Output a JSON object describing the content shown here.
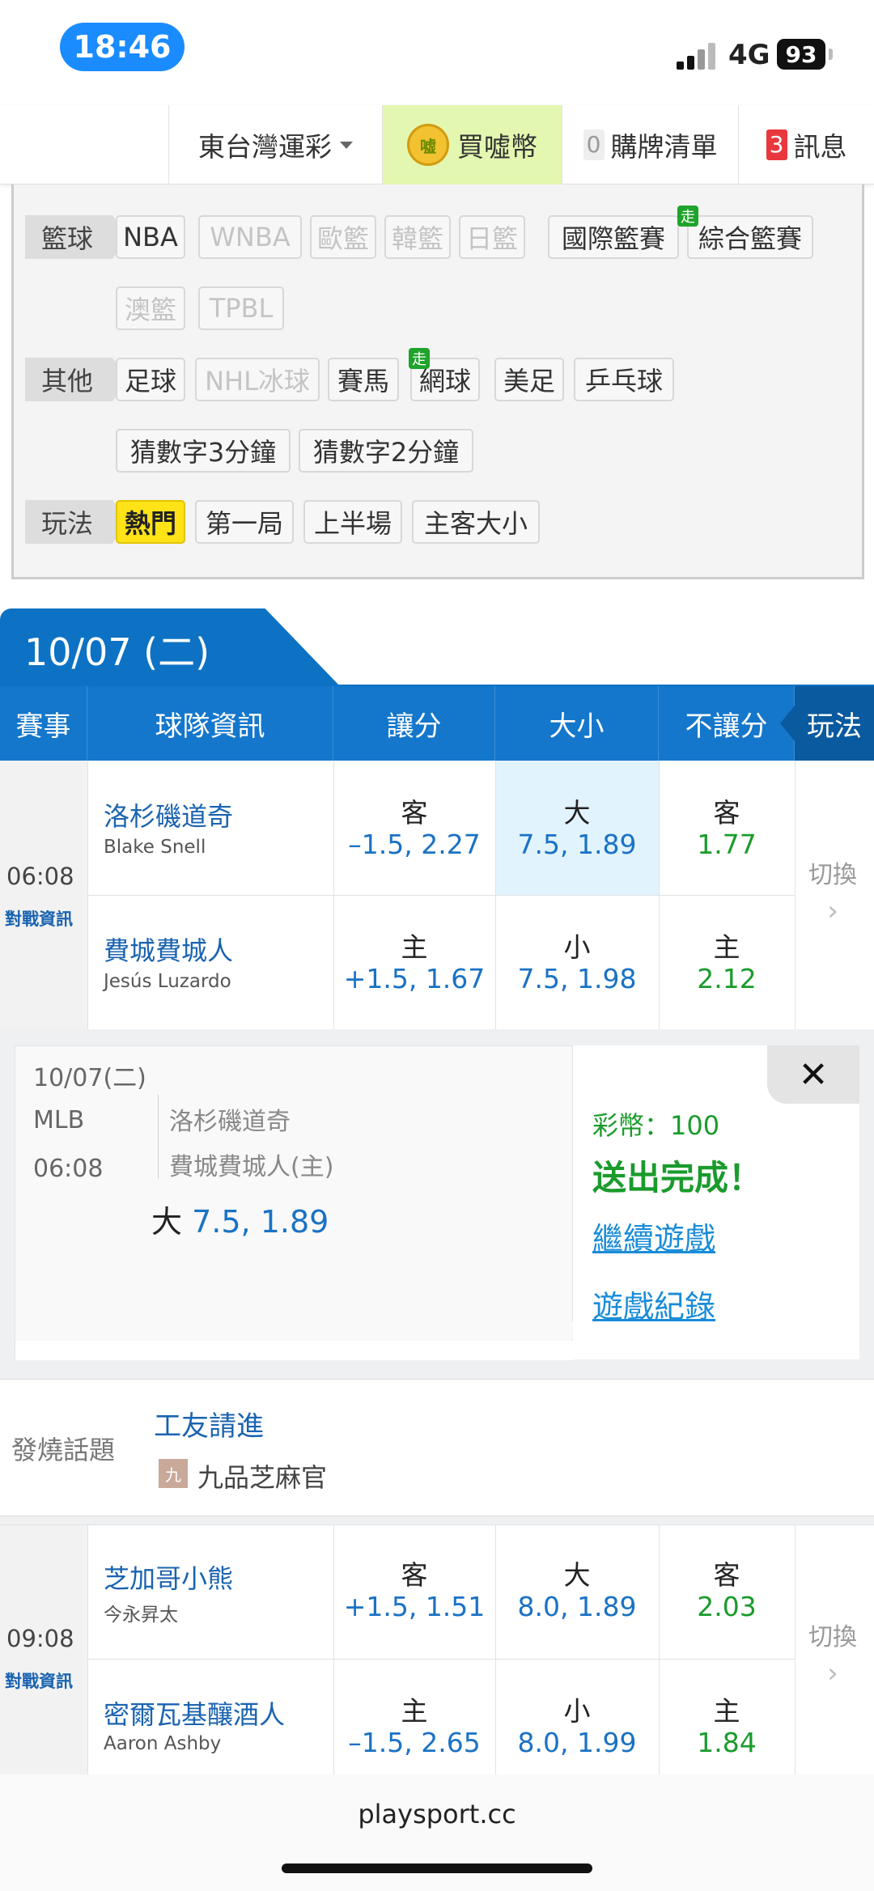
{
  "status_bar": {
    "time": "18:46",
    "network": "4G",
    "battery": "93"
  },
  "nav": {
    "lottery": "東台灣運彩",
    "coin_icon_text": "嘘",
    "buy_coin": "買噓幣",
    "cart_count": "0",
    "cart": "購牌清單",
    "msg_count": "3",
    "messages": "訊息"
  },
  "filter": {
    "basketball": {
      "label": "籃球",
      "chips": [
        "NBA",
        "WNBA",
        "歐籃",
        "韓籃",
        "日籃",
        "國際籃賽",
        "綜合籃賽",
        "澳籃",
        "TPBL"
      ]
    },
    "other": {
      "label": "其他",
      "chips": [
        "足球",
        "NHL冰球",
        "賽馬",
        "網球",
        "美足",
        "乒乓球",
        "猜數字3分鐘",
        "猜數字2分鐘"
      ]
    },
    "play": {
      "label": "玩法",
      "chips": [
        "熱門",
        "第一局",
        "上半場",
        "主客大小"
      ]
    },
    "walk_badge": "走"
  },
  "date_tab": "10/07 (二)",
  "table_header": {
    "event": "賽事",
    "team_info": "球隊資訊",
    "spread": "讓分",
    "total": "大小",
    "moneyline": "不讓分",
    "play": "玩法"
  },
  "games": [
    {
      "time": "06:08",
      "vs_link": "對戰資訊",
      "switch": "切換",
      "away": {
        "team": "洛杉磯道奇",
        "pitcher": "Blake Snell",
        "spread_lbl": "客",
        "spread": "–1.5, 2.27",
        "total_lbl": "大",
        "total": "7.5, 1.89",
        "ml_lbl": "客",
        "ml": "1.77"
      },
      "home": {
        "team": "費城費城人",
        "pitcher": "Jesús Luzardo",
        "spread_lbl": "主",
        "spread": "+1.5, 1.67",
        "total_lbl": "小",
        "total": "7.5, 1.98",
        "ml_lbl": "主",
        "ml": "2.12"
      }
    },
    {
      "time": "09:08",
      "vs_link": "對戰資訊",
      "switch": "切換",
      "away": {
        "team": "芝加哥小熊",
        "pitcher": "今永昇太",
        "spread_lbl": "客",
        "spread": "+1.5, 1.51",
        "total_lbl": "大",
        "total": "8.0, 1.89",
        "ml_lbl": "客",
        "ml": "2.03"
      },
      "home": {
        "team": "密爾瓦基釀酒人",
        "pitcher": "Aaron Ashby",
        "spread_lbl": "主",
        "spread": "–1.5, 2.65",
        "total_lbl": "小",
        "total": "8.0, 1.99",
        "ml_lbl": "主",
        "ml": "1.84"
      }
    }
  ],
  "receipt": {
    "date": "10/07(二)",
    "league": "MLB",
    "time": "06:08",
    "team1": "洛杉磯道奇",
    "team2": "費城費城人(主)",
    "pick_lbl": "大",
    "pick_val": "7.5, 1.89",
    "coins": "彩幣：100",
    "sent": "送出完成！",
    "continue": "繼續遊戲",
    "history": "遊戲紀錄",
    "close": "✕"
  },
  "topic": {
    "label": "發燒話題",
    "title": "工友請進",
    "avatar_char": "九",
    "author": "九品芝麻官"
  },
  "footer": {
    "url": "playsport.cc"
  },
  "colors": {
    "primary_blue": "#1477cc",
    "odds_blue": "#1a72c4",
    "odds_green": "#1a9b2c",
    "hot_yellow": "#ffe317",
    "coin_bg": "#e3f7b0",
    "badge_red": "#e8383d"
  }
}
